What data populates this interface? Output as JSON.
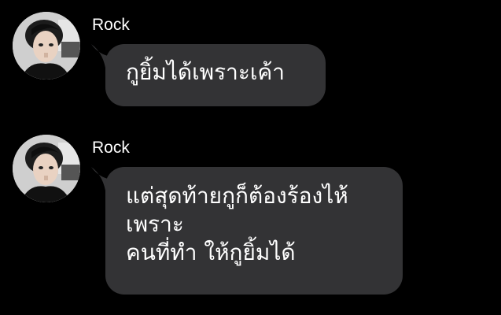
{
  "messages": [
    {
      "sender": "Rock",
      "lines": [
        "กูยิ้มได้เพราะเค้า"
      ]
    },
    {
      "sender": "Rock",
      "lines": [
        "แต่สุดท้ายกูก็ต้องร้องไห้",
        "เพราะ",
        "คนที่ทำ ให้กูยิ้มได้"
      ]
    }
  ],
  "colors": {
    "background": "#000000",
    "bubble": "#333335",
    "text": "#ffffff"
  }
}
